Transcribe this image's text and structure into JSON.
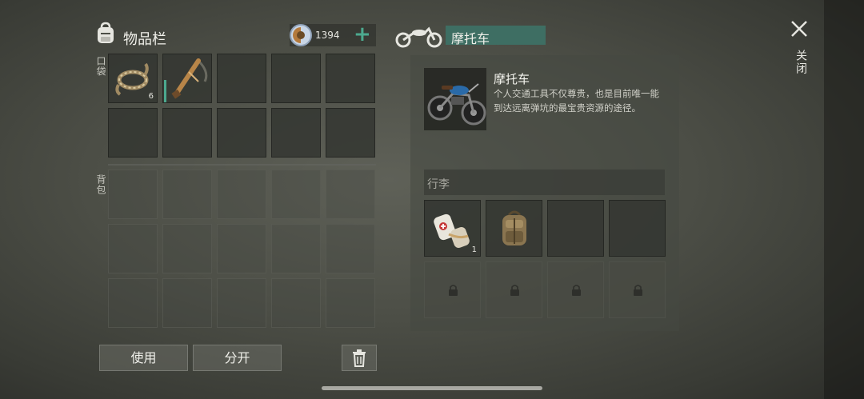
{
  "inventory": {
    "title": "物品栏",
    "pocket_label": "口袋",
    "backpack_label": "背包"
  },
  "currency": {
    "amount": "1394",
    "add_symbol": "+"
  },
  "pocket_items": [
    {
      "name": "rope",
      "count": "6"
    },
    {
      "name": "crossbow",
      "count": ""
    }
  ],
  "vehicle": {
    "title": "摩托车"
  },
  "detail": {
    "name": "摩托车",
    "description": "个人交通工具不仅尊贵，也是目前唯一能到达远离弹坑的最宝贵资源的途径。"
  },
  "luggage": {
    "label": "行李",
    "items": [
      {
        "name": "bandage",
        "count": "1"
      },
      {
        "name": "backpack",
        "count": ""
      }
    ]
  },
  "buttons": {
    "use": "使用",
    "split": "分开"
  },
  "close": {
    "label": "关闭"
  },
  "colors": {
    "accent_green": "#4ca98f",
    "title_box": "#3e6e63"
  }
}
